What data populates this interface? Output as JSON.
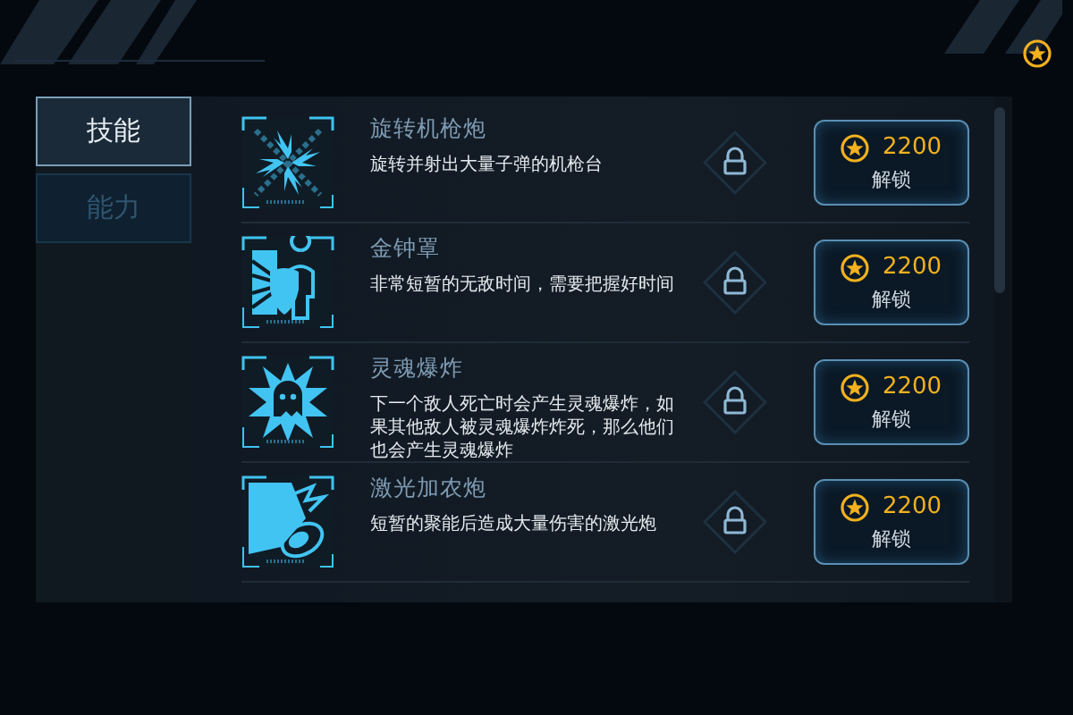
{
  "tabs": [
    {
      "label": "技能",
      "selected": true
    },
    {
      "label": "能力",
      "selected": false
    }
  ],
  "skills": [
    {
      "name": "旋转机枪炮",
      "description": "旋转并射出大量子弹的机枪台",
      "locked": true,
      "price": "2200",
      "action": "解锁"
    },
    {
      "name": "金钟罩",
      "description": "非常短暂的无敌时间，需要把握好时间",
      "locked": true,
      "price": "2200",
      "action": "解锁"
    },
    {
      "name": "灵魂爆炸",
      "description": "下一个敌人死亡时会产生灵魂爆炸，如果其他敌人被灵魂爆炸炸死，那么他们也会产生灵魂爆炸",
      "locked": true,
      "price": "2200",
      "action": "解锁"
    },
    {
      "name": "激光加农炮",
      "description": "短暂的聚能后造成大量伤害的激光炮",
      "locked": true,
      "price": "2200",
      "action": "解锁"
    }
  ]
}
